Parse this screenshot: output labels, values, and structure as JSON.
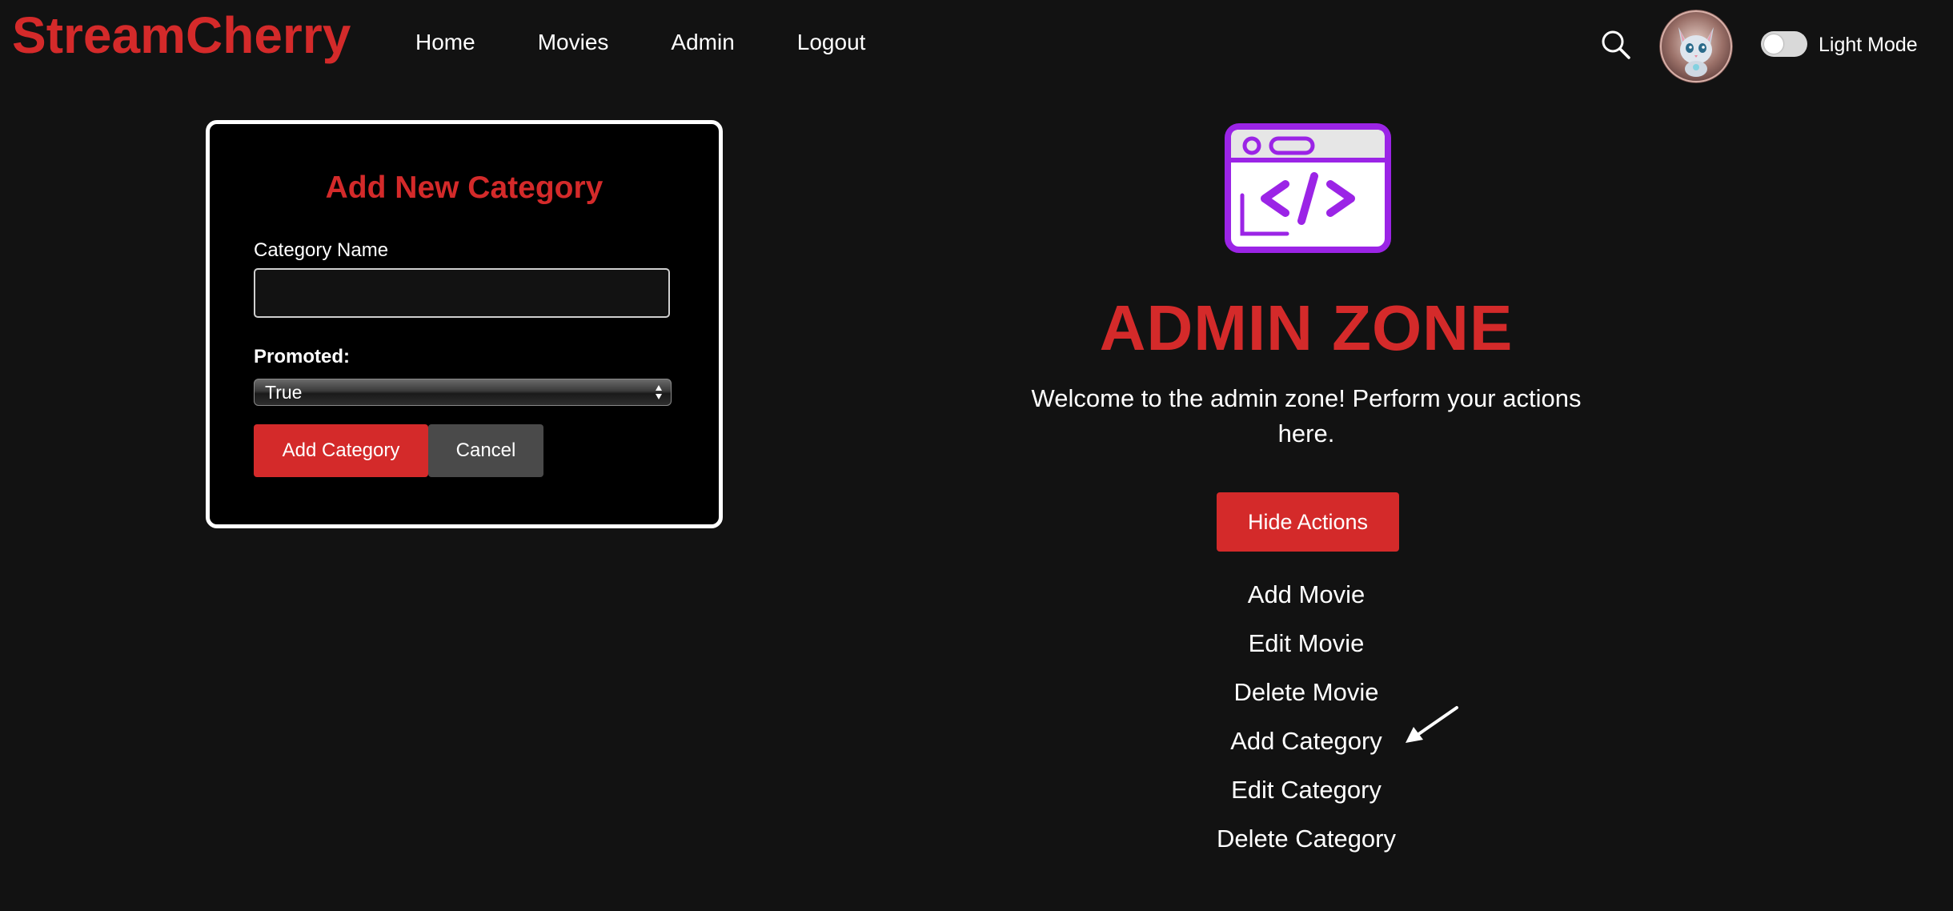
{
  "header": {
    "brand": "StreamCherry",
    "nav": [
      {
        "label": "Home"
      },
      {
        "label": "Movies"
      },
      {
        "label": "Admin"
      },
      {
        "label": "Logout"
      }
    ],
    "search_icon": "search-icon",
    "avatar_icon": "cat-avatar",
    "theme_toggle": {
      "label": "Light Mode",
      "on": false
    }
  },
  "form": {
    "title": "Add New Category",
    "category_name_label": "Category Name",
    "category_name_value": "",
    "promoted_label": "Promoted:",
    "promoted_selected": "True",
    "add_button": "Add Category",
    "cancel_button": "Cancel"
  },
  "admin": {
    "icon": "code-window-icon",
    "title": "ADMIN ZONE",
    "welcome": "Welcome to the admin zone! Perform your actions here.",
    "hide_button": "Hide Actions",
    "actions": [
      {
        "label": "Add Movie"
      },
      {
        "label": "Edit Movie"
      },
      {
        "label": "Delete Movie"
      },
      {
        "label": "Add Category"
      },
      {
        "label": "Edit Category"
      },
      {
        "label": "Delete Category"
      }
    ],
    "pointer_icon": "arrow-pointer-icon"
  },
  "colors": {
    "background": "#121212",
    "brand_red": "#d42a2a",
    "accent_purple": "#9b24e6",
    "cancel_gray": "#4a4a4a"
  }
}
